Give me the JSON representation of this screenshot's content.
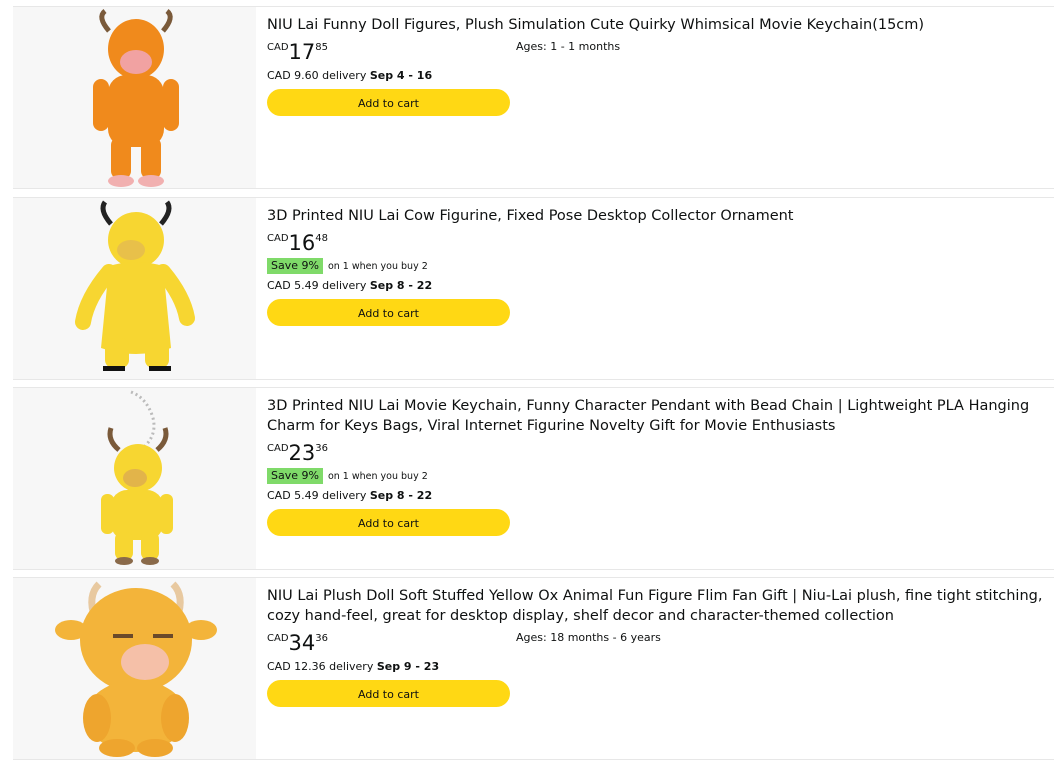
{
  "colors": {
    "button": "#ffd814",
    "save_badge": "#7fda69",
    "thumb_bg": "#f7f7f7"
  },
  "items": [
    {
      "title": "NIU Lai Funny Doll Figures, Plush Simulation Cute Quirky Whimsical Movie Keychain(15cm)",
      "currency": "CAD",
      "price_whole": "17",
      "price_fraction": "85",
      "ages": "Ages: 1 - 1 months",
      "delivery_prefix": "CAD 9.60 delivery",
      "delivery_dates": "Sep 4 - 16",
      "button": "Add to cart",
      "image_icon": "orange-plush-cow-figure"
    },
    {
      "title": "3D Printed NIU Lai Cow Figurine, Fixed Pose Desktop Collector Ornament",
      "currency": "CAD",
      "price_whole": "16",
      "price_fraction": "48",
      "save_badge": "Save 9%",
      "save_note": "on 1 when you buy 2",
      "delivery_prefix": "CAD 5.49 delivery",
      "delivery_dates": "Sep 8 - 22",
      "button": "Add to cart",
      "image_icon": "yellow-cow-figurine"
    },
    {
      "title": "3D Printed NIU Lai Movie Keychain, Funny Character Pendant with Bead Chain | Lightweight PLA Hanging Charm for Keys Bags, Viral Internet Figurine Novelty Gift for Movie Enthusiasts",
      "currency": "CAD",
      "price_whole": "23",
      "price_fraction": "36",
      "save_badge": "Save 9%",
      "save_note": "on 1 when you buy 2",
      "delivery_prefix": "CAD 5.49 delivery",
      "delivery_dates": "Sep 8 - 22",
      "button": "Add to cart",
      "image_icon": "yellow-cow-keychain"
    },
    {
      "title": "NIU Lai Plush Doll Soft Stuffed Yellow Ox Animal Fun Figure Flim Fan Gift | Niu-Lai plush, fine tight stitching, cozy hand-feel, great for desktop display, shelf decor and character-themed collection",
      "currency": "CAD",
      "price_whole": "34",
      "price_fraction": "36",
      "ages": "Ages: 18 months - 6 years",
      "delivery_prefix": "CAD 12.36 delivery",
      "delivery_dates": "Sep 9 - 23",
      "button": "Add to cart",
      "image_icon": "yellow-ox-plush-doll"
    }
  ]
}
